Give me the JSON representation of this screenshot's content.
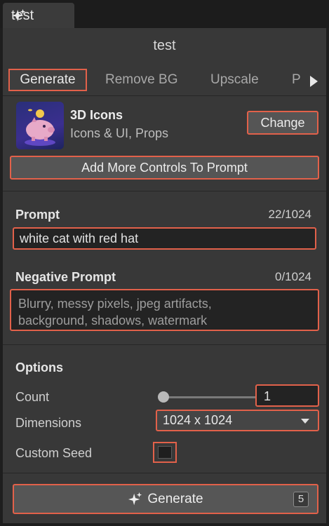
{
  "window": {
    "tab_title": "test",
    "tab_icon": "sparkle-icon"
  },
  "panel": {
    "title": "test"
  },
  "tabs": [
    {
      "label": "Generate",
      "active": true
    },
    {
      "label": "Remove BG",
      "active": false
    },
    {
      "label": "Upscale",
      "active": false
    },
    {
      "label": "P",
      "active": false
    }
  ],
  "model": {
    "name": "3D Icons",
    "tags": "Icons & UI, Props",
    "change_label": "Change",
    "thumbnail_icon": "piggy-bank-icon"
  },
  "add_controls_label": "Add More Controls To Prompt",
  "prompt": {
    "label": "Prompt",
    "counter": "22/1024",
    "value": "white cat with red hat"
  },
  "negative_prompt": {
    "label": "Negative Prompt",
    "counter": "0/1024",
    "placeholder_line1": "Blurry, messy pixels, jpeg artifacts,",
    "placeholder_line2": "background, shadows, watermark"
  },
  "options": {
    "heading": "Options",
    "count_label": "Count",
    "count_value": "1",
    "dimensions_label": "Dimensions",
    "dimensions_value": "1024 x 1024",
    "seed_label": "Custom Seed",
    "seed_checked": false
  },
  "generate": {
    "label": "Generate",
    "cost": "5",
    "icon": "sparkle-icon"
  },
  "colors": {
    "highlight": "#e2614a",
    "panel_bg": "#383838",
    "field_bg": "#232323"
  }
}
